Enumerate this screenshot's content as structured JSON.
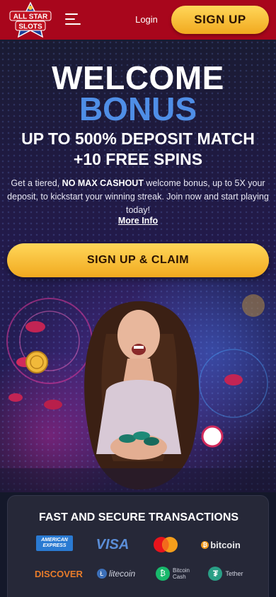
{
  "header": {
    "logo_alt": "All Star Slots",
    "login_label": "Login",
    "signup_label": "SIGN UP"
  },
  "hero": {
    "title_line1": "WELCOME",
    "title_line2": "BONUS",
    "subtitle": "UP TO 500% DEPOSIT MATCH +10 FREE SPINS",
    "desc_prefix": "Get a tiered, ",
    "desc_bold": "NO MAX CASHOUT",
    "desc_suffix": " welcome bonus, up to 5X your deposit, to kickstart your winning streak. Join now and start playing today!",
    "more_info": "More Info",
    "claim_label": "SIGN UP & CLAIM"
  },
  "transactions": {
    "title": "FAST AND SECURE TRANSACTIONS",
    "methods": {
      "amex_line1": "AMERICAN",
      "amex_line2": "EXPRESS",
      "visa": "VISA",
      "bitcoin": "bitcoin",
      "discover": "DISCOVER",
      "litecoin": "litecoin",
      "bch_line1": "Bitcoin",
      "bch_line2": "Cash",
      "tether": "Tether"
    }
  },
  "colors": {
    "header_bg": "#a8061c",
    "accent_gold": "#f1a91f",
    "bonus_blue": "#4f8ee6",
    "card_bg": "#262838"
  }
}
